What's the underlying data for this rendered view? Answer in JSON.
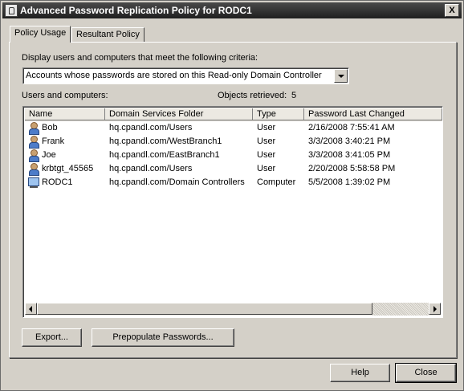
{
  "window": {
    "title": "Advanced Password Replication Policy for RODC1",
    "close_glyph": "X"
  },
  "tabs": [
    {
      "label": "Policy Usage",
      "active": true
    },
    {
      "label": "Resultant Policy",
      "active": false
    }
  ],
  "criteria": {
    "label": "Display users and computers that meet the following criteria:",
    "selected": "Accounts whose passwords are stored on this Read-only Domain Controller"
  },
  "list": {
    "label": "Users and computers:",
    "retrieved_label": "Objects retrieved:",
    "retrieved_count": "5",
    "columns": [
      "Name",
      "Domain Services Folder",
      "Type",
      "Password Last Changed"
    ],
    "rows": [
      {
        "icon": "user-icon",
        "name": "Bob",
        "folder": "hq.cpandl.com/Users",
        "type": "User",
        "changed": "2/16/2008 7:55:41 AM"
      },
      {
        "icon": "user-icon",
        "name": "Frank",
        "folder": "hq.cpandl.com/WestBranch1",
        "type": "User",
        "changed": "3/3/2008 3:40:21 PM"
      },
      {
        "icon": "user-icon",
        "name": "Joe",
        "folder": "hq.cpandl.com/EastBranch1",
        "type": "User",
        "changed": "3/3/2008 3:41:05 PM"
      },
      {
        "icon": "user-icon",
        "name": "krbtgt_45565",
        "folder": "hq.cpandl.com/Users",
        "type": "User",
        "changed": "2/20/2008 5:58:58 PM"
      },
      {
        "icon": "computer-icon",
        "name": "RODC1",
        "folder": "hq.cpandl.com/Domain Controllers",
        "type": "Computer",
        "changed": "5/5/2008 1:39:02 PM"
      }
    ]
  },
  "buttons": {
    "export": "Export...",
    "prepopulate": "Prepopulate Passwords...",
    "help": "Help",
    "close": "Close"
  }
}
